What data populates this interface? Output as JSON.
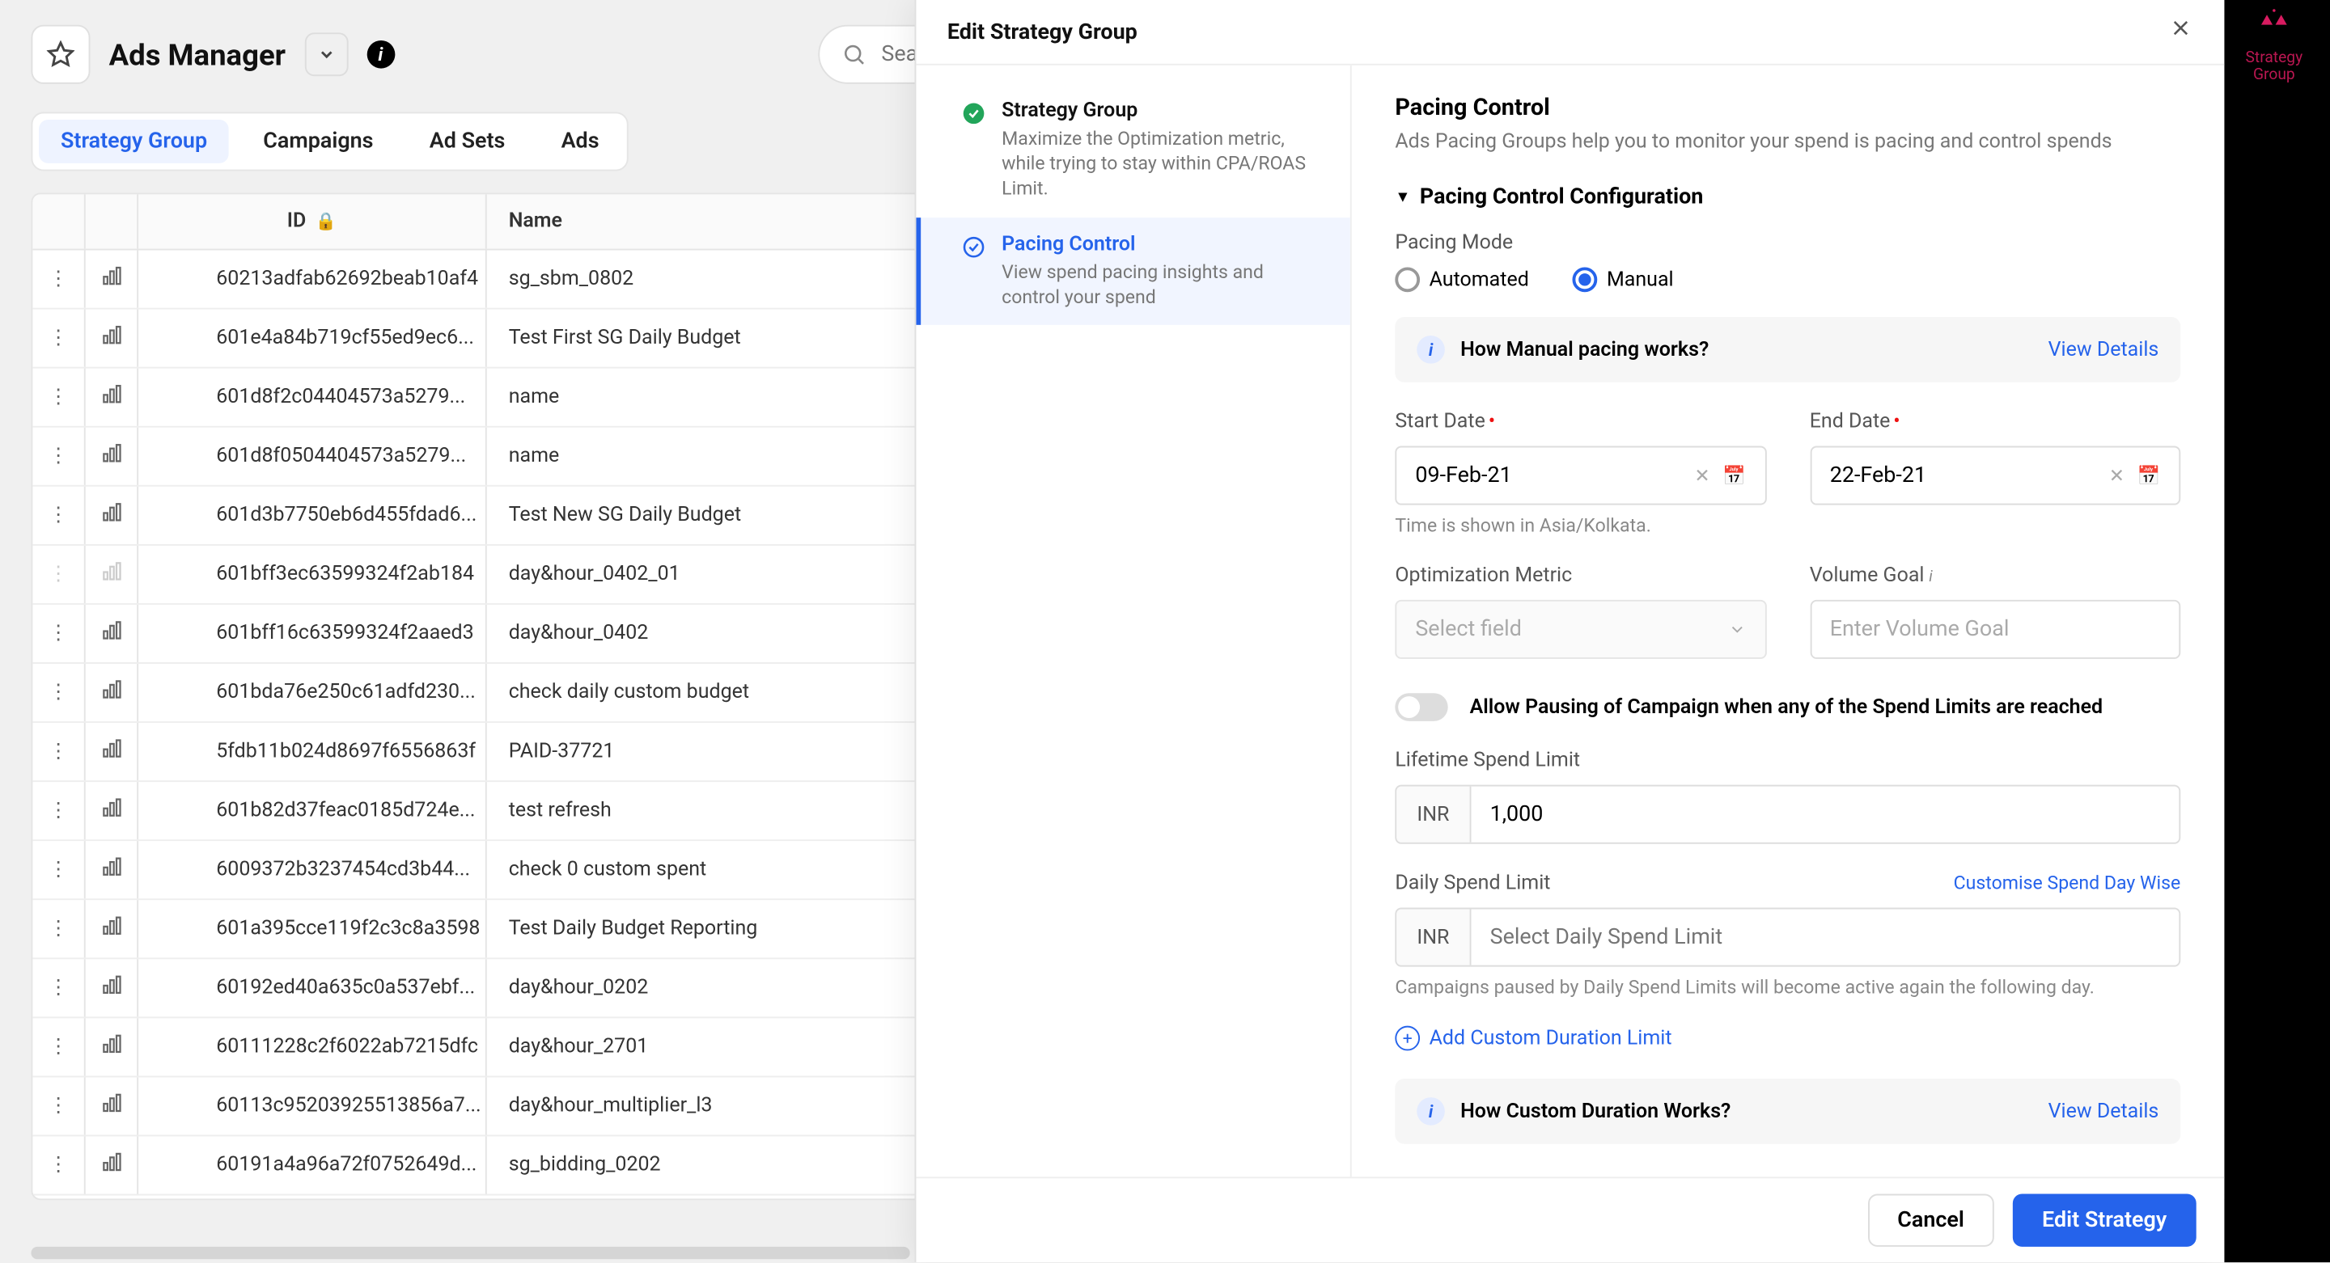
{
  "header": {
    "title": "Ads Manager",
    "search_placeholder": "Search Strategy G"
  },
  "tabs": [
    "Strategy Group",
    "Campaigns",
    "Ad Sets",
    "Ads"
  ],
  "table": {
    "columns": {
      "id": "ID",
      "name": "Name"
    },
    "rows": [
      {
        "id": "60213adfab62692beab10af4",
        "name": "sg_sbm_0802",
        "disabled": false
      },
      {
        "id": "601e4a84b719cf55ed9ec6...",
        "name": "Test First SG Daily Budget",
        "disabled": false
      },
      {
        "id": "601d8f2c04404573a5279...",
        "name": "name",
        "disabled": false
      },
      {
        "id": "601d8f0504404573a5279...",
        "name": "name",
        "disabled": false
      },
      {
        "id": "601d3b7750eb6d455fdad6...",
        "name": "Test New SG Daily Budget",
        "disabled": false
      },
      {
        "id": "601bff3ec63599324f2ab184",
        "name": "day&hour_0402_01",
        "disabled": true
      },
      {
        "id": "601bff16c63599324f2aaed3",
        "name": "day&hour_0402",
        "disabled": false
      },
      {
        "id": "601bda76e250c61adfd230...",
        "name": "check daily custom budget",
        "disabled": false
      },
      {
        "id": "5fdb11b024d8697f6556863f",
        "name": "PAID-37721",
        "disabled": false
      },
      {
        "id": "601b82d37feac0185d724e...",
        "name": "test refresh",
        "disabled": false
      },
      {
        "id": "6009372b3237454cd3b44...",
        "name": "check 0 custom spent",
        "disabled": false
      },
      {
        "id": "601a395cce119f2c3c8a3598",
        "name": "Test Daily Budget Reporting",
        "disabled": false
      },
      {
        "id": "60192ed40a635c0a537ebf...",
        "name": "day&hour_0202",
        "disabled": false
      },
      {
        "id": "60111228c2f6022ab7215dfc",
        "name": "day&hour_2701",
        "disabled": false
      },
      {
        "id": "60113c9520392551385­6a7...",
        "name": "day&hour_multiplier_l3",
        "disabled": false
      },
      {
        "id": "60191a4a96a72f0752649d...",
        "name": "sg_bidding_0202",
        "disabled": false
      }
    ]
  },
  "drawer": {
    "title": "Edit Strategy Group",
    "steps": [
      {
        "title": "Strategy Group",
        "desc": "Maximize the Optimization metric, while trying to stay within CPA/ROAS Limit."
      },
      {
        "title": "Pacing Control",
        "desc": "View spend pacing insights and control your spend"
      }
    ],
    "pacing": {
      "heading": "Pacing Control",
      "sub": "Ads Pacing Groups help you to monitor your spend is pacing and control spends",
      "config_title": "Pacing Control Configuration",
      "mode_label": "Pacing Mode",
      "mode_automated": "Automated",
      "mode_manual": "Manual",
      "info1": "How Manual pacing works?",
      "view_details": "View Details",
      "start_label": "Start Date",
      "end_label": "End Date",
      "start_value": "09-Feb-21",
      "end_value": "22-Feb-21",
      "tz": "Time is shown in Asia/Kolkata.",
      "opt_label": "Optimization Metric",
      "opt_placeholder": "Select field",
      "vol_label": "Volume Goal",
      "vol_placeholder": "Enter Volume Goal",
      "toggle_label": "Allow Pausing of Campaign when any of the Spend Limits are reached",
      "lifetime_label": "Lifetime Spend Limit",
      "currency": "INR",
      "lifetime_value": "1,000",
      "daily_label": "Daily Spend Limit",
      "customise": "Customise Spend Day Wise",
      "daily_placeholder": "Select Daily Spend Limit",
      "daily_hint": "Campaigns paused by Daily Spend Limits will become active again the following day.",
      "add_custom": "Add Custom Duration Limit",
      "info2": "How Custom Duration Works?"
    },
    "footer": {
      "cancel": "Cancel",
      "submit": "Edit Strategy"
    }
  },
  "sg_badge": "Strategy Group"
}
